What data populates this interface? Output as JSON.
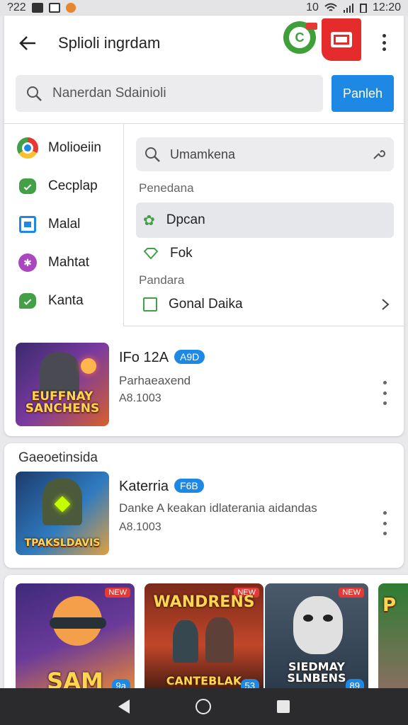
{
  "status_bar": {
    "left_text": "?22",
    "right_icon_text": "10",
    "time": "12:20"
  },
  "header": {
    "title": "Splioli ingrdam"
  },
  "search": {
    "placeholder": "Nanerdan Sdainioli",
    "button_label": "Panleh"
  },
  "sidebar": {
    "items": [
      {
        "label": "Molioeiin",
        "icon": "chrome-icon"
      },
      {
        "label": "Cecplap",
        "icon": "chat-icon"
      },
      {
        "label": "Malal",
        "icon": "image-icon"
      },
      {
        "label": "Mahtat",
        "icon": "star-icon"
      },
      {
        "label": "Kanta",
        "icon": "message-icon"
      }
    ]
  },
  "dropdown": {
    "search_placeholder": "Umamkena",
    "section1_label": "Penedana",
    "options": [
      {
        "label": "Dpcan",
        "icon": "gear-icon",
        "selected": true
      },
      {
        "label": "Fok",
        "icon": "diamond-icon",
        "selected": false
      }
    ],
    "section2_label": "Pandara",
    "checkbox_label": "Gonal Daika"
  },
  "app_list": [
    {
      "name": "IFo 12A",
      "badge": "A9D",
      "subtitle": "Parhaeaxend",
      "meta": "A8.1003",
      "thumb_caption": "EUFFNAY SANCHENS"
    },
    {
      "section_title": "Gaeoetinsida",
      "name": "Katerria",
      "badge": "F6B",
      "subtitle": "Danke A keakan idlaterania aidandas",
      "meta": "A8.1003",
      "thumb_caption": "TPAKSLDAVIS"
    }
  ],
  "game_strip": [
    {
      "caption": "SAM",
      "pill": "9a",
      "tag": "NEW"
    },
    {
      "caption_top": "WANDRENS",
      "caption": "CANTEBLAK",
      "pill": "53",
      "tag": "NEW"
    },
    {
      "caption": "SIEDMAY SLNBENS",
      "pill": "89",
      "tag": "NEW"
    },
    {
      "caption": "P",
      "pill": "",
      "tag": ""
    }
  ],
  "colors": {
    "accent": "#1e88e5",
    "red": "#e53935",
    "green": "#3fa03a"
  }
}
